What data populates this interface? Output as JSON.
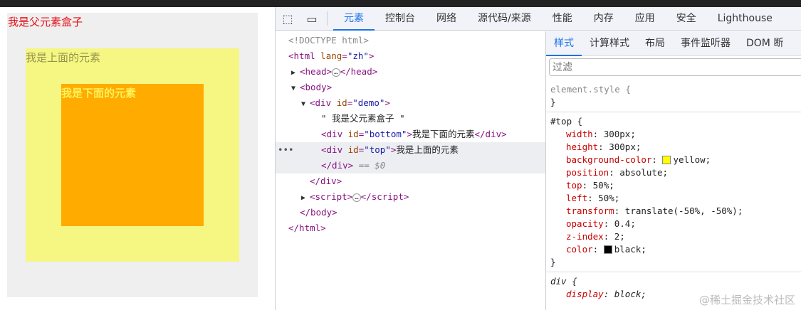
{
  "page": {
    "parent_text": "我是父元素盒子",
    "top_text": "我是上面的元素",
    "bottom_text": "我是下面的元素"
  },
  "devtools": {
    "tabs": [
      "元素",
      "控制台",
      "网络",
      "源代码/来源",
      "性能",
      "内存",
      "应用",
      "安全",
      "Lighthouse"
    ],
    "dom": {
      "doctype": "<!DOCTYPE html>",
      "html_open": "<html",
      "lang_attr": "lang",
      "lang_val": "\"zh\"",
      "head": "<head>",
      "head_close": "</head>",
      "body": "<body>",
      "div": "<div",
      "id": "id",
      "demo": "\"demo\"",
      "text": "\" 我是父元素盒子 \"",
      "bottom": "\"bottom\"",
      "bottom_text": "我是下面的元素",
      "top": "\"top\"",
      "top_text": "我是上面的元素",
      "div_close": "</div>",
      "sel_marker": "== $0",
      "script": "<script>",
      "script_close": "</script>",
      "body_close": "</body>",
      "html_close": "</html>",
      "gt": ">",
      "ellipsis": "…"
    },
    "styles_tabs": [
      "样式",
      "计算样式",
      "布局",
      "事件监听器",
      "DOM 断"
    ],
    "filter_placeholder": "过滤",
    "element_style": "element.style {",
    "top_selector": "#top {",
    "top_props": [
      [
        "width",
        "300px;"
      ],
      [
        "height",
        "300px;"
      ],
      [
        "background-color",
        "yellow;"
      ],
      [
        "position",
        "absolute;"
      ],
      [
        "top",
        "50%;"
      ],
      [
        "left",
        "50%;"
      ],
      [
        "transform",
        "translate(-50%, -50%);"
      ],
      [
        "opacity",
        "0.4;"
      ],
      [
        "z-index",
        "2;"
      ],
      [
        "color",
        "black;"
      ]
    ],
    "div_selector": "div {",
    "div_props": [
      [
        "display",
        "block;"
      ]
    ],
    "close_brace": "}",
    "swatch_colors": {
      "background-color": "#ffff00",
      "color": "#000000"
    }
  },
  "watermark": "@稀土掘金技术社区"
}
